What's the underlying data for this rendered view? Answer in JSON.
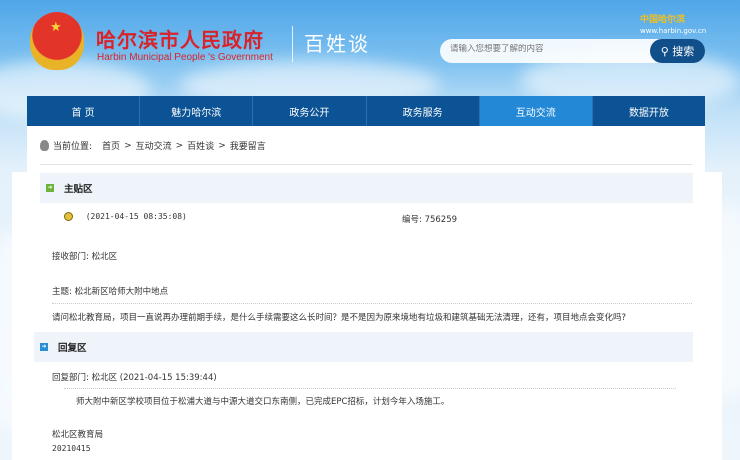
{
  "header": {
    "title_cn": "哈尔滨市人民政府",
    "title_en": "Harbin Municipal People 's Government",
    "subtitle": "百姓谈",
    "gov_logo": "中国哈尔滨",
    "gov_url": "www.harbin.gov.cn"
  },
  "search": {
    "placeholder": "请输入您想要了解的内容",
    "button": "搜索"
  },
  "nav": [
    "首 页",
    "魅力哈尔滨",
    "政务公开",
    "政务服务",
    "互动交流",
    "数据开放"
  ],
  "breadcrumb": {
    "label": "当前位置:",
    "items": [
      "首页",
      "互动交流",
      "百姓谈",
      "我要留言"
    ],
    "sep": ">"
  },
  "post": {
    "section": "主贴区",
    "time": "(2021-04-15 08:35:08)",
    "number": "编号: 756259",
    "dept": "接收部门: 松北区",
    "subject": "主题: 松北新区哈师大附中地点",
    "body": "请问松北教育局，项目一直说再办理前期手续，是什么手续需要这么长时间？是不是因为原来境地有垃圾和建筑基础无法清理，还有，项目地点会变化吗?"
  },
  "reply": {
    "section": "回复区",
    "dept": "回复部门: 松北区 (2021-04-15 15:39:44)",
    "body": "师大附中新区学校项目位于松浦大道与中源大道交口东南侧，已完成EPC招标，计划今年入场施工。",
    "signature": "松北区教育局",
    "date": "20210415"
  }
}
